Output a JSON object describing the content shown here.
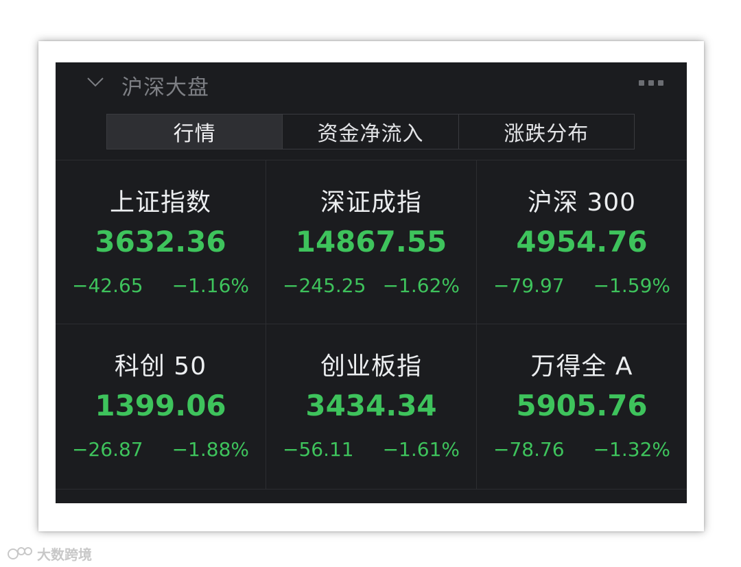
{
  "header": {
    "title": "沪深大盘",
    "collapse_icon": "chevron-down-icon",
    "more_icon": "more-dots-icon"
  },
  "tabs": [
    {
      "label": "行情",
      "active": true
    },
    {
      "label": "资金净流入",
      "active": false
    },
    {
      "label": "涨跌分布",
      "active": false
    }
  ],
  "indices": [
    {
      "name": "上证指数",
      "value": "3632.36",
      "change": "−42.65",
      "pct": "−1.16%"
    },
    {
      "name": "深证成指",
      "value": "14867.55",
      "change": "−245.25",
      "pct": "−1.62%"
    },
    {
      "name": "沪深 300",
      "value": "4954.76",
      "change": "−79.97",
      "pct": "−1.59%"
    },
    {
      "name": "科创 50",
      "value": "1399.06",
      "change": "−26.87",
      "pct": "−1.88%"
    },
    {
      "name": "创业板指",
      "value": "3434.34",
      "change": "−56.11",
      "pct": "−1.61%"
    },
    {
      "name": "万得全 A",
      "value": "5905.76",
      "change": "−78.76",
      "pct": "−1.32%"
    }
  ],
  "colors": {
    "panel_bg": "#1b1c1f",
    "down": "#3ec35c",
    "text": "#eceef0",
    "muted": "#7d7f84"
  },
  "watermark": {
    "text": "大数跨境"
  }
}
